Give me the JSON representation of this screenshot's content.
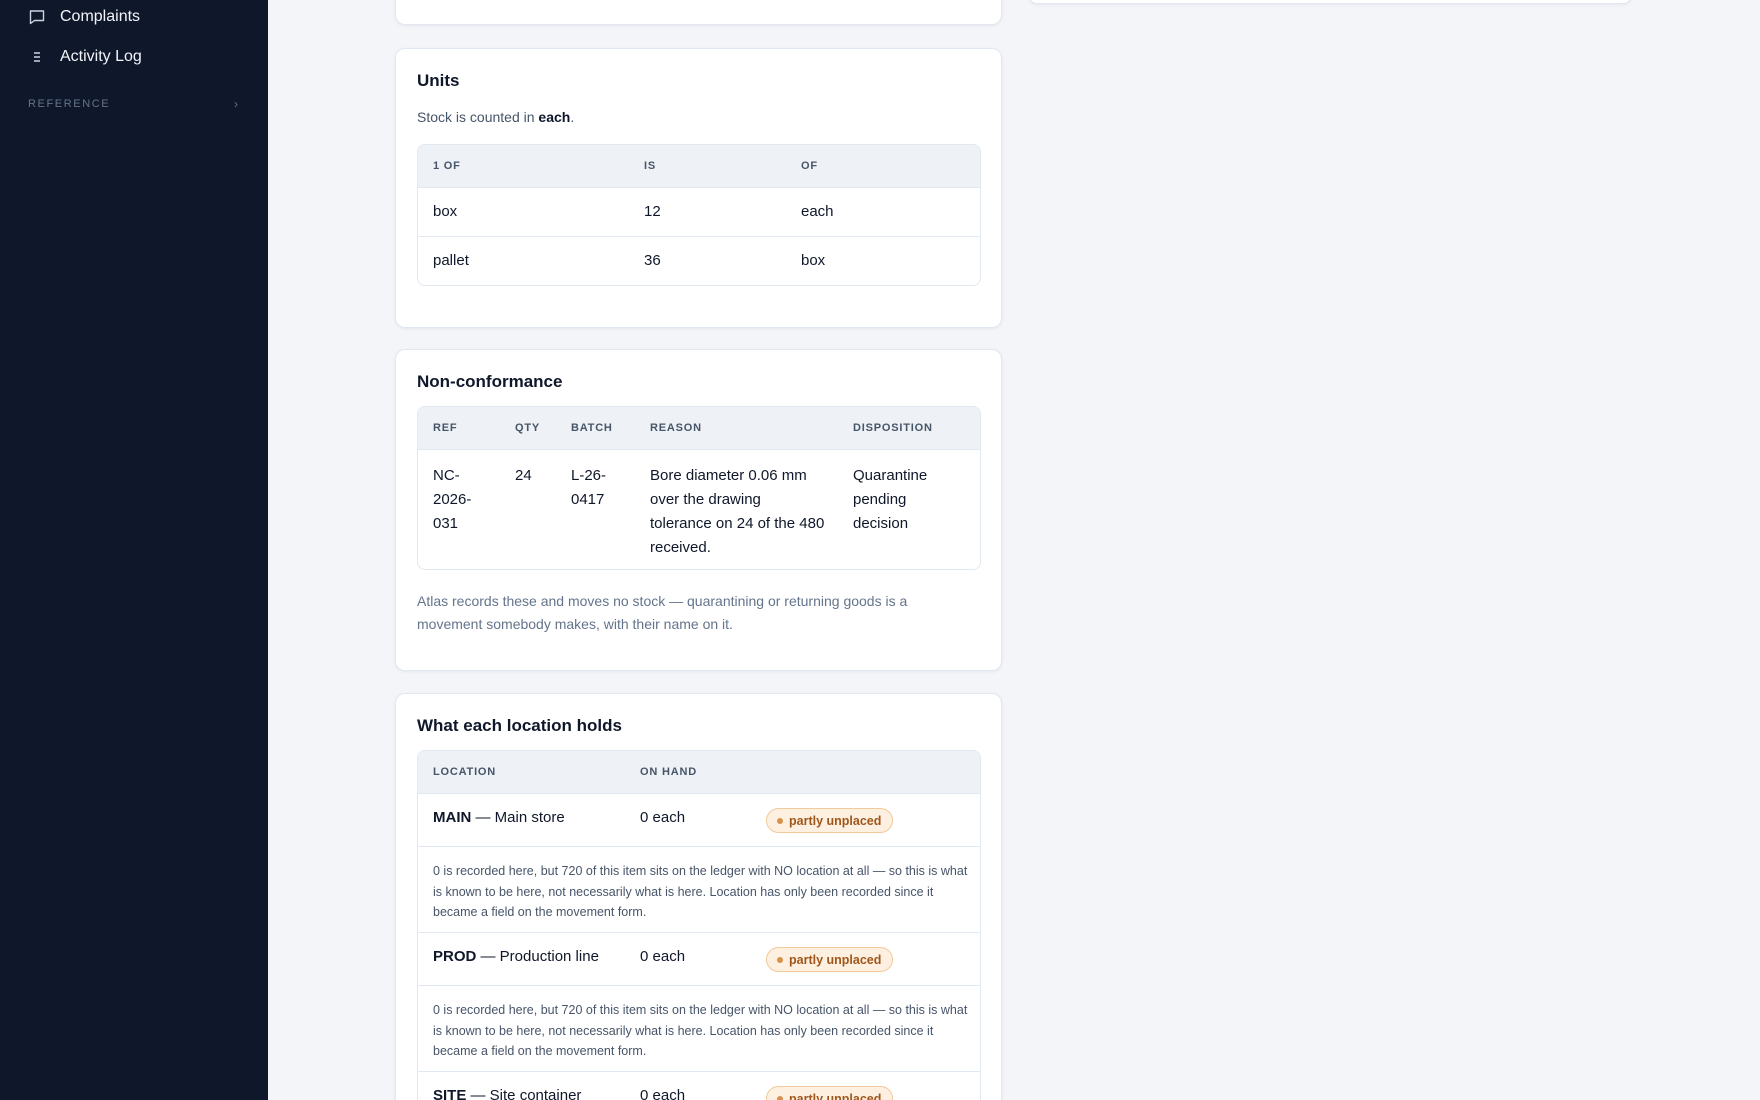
{
  "sidebar": {
    "items": [
      {
        "label": "Complaints",
        "icon": "message-square-icon"
      },
      {
        "label": "Activity Log",
        "icon": "list-icon"
      }
    ],
    "section": {
      "label": "REFERENCE"
    }
  },
  "units": {
    "title": "Units",
    "subtitle_prefix": "Stock is counted in ",
    "subtitle_unit": "each",
    "subtitle_suffix": ".",
    "columns": [
      "1 OF",
      "IS",
      "OF"
    ],
    "rows": [
      {
        "unit": "box",
        "qty": "12",
        "of": "each"
      },
      {
        "unit": "pallet",
        "qty": "36",
        "of": "box"
      }
    ]
  },
  "nonconformance": {
    "title": "Non-conformance",
    "columns": [
      "REF",
      "QTY",
      "BATCH",
      "REASON",
      "DISPOSITION"
    ],
    "rows": [
      {
        "ref": "NC-2026-031",
        "qty": "24",
        "batch": "L-26-0417",
        "reason": "Bore diameter 0.06 mm over the drawing tolerance on 24 of the 480 received.",
        "disposition": "Quarantine pending decision"
      }
    ],
    "note": "Atlas records these and moves no stock — quarantining or returning goods is a movement somebody makes, with their name on it."
  },
  "locations": {
    "title": "What each location holds",
    "columns": [
      "LOCATION",
      "ON HAND"
    ],
    "rows": [
      {
        "code": "MAIN",
        "name": " — Main store",
        "on_hand": "0 each",
        "badge": "partly unplaced",
        "note": "0 is recorded here, but 720 of this item sits on the ledger with NO location at all — so this is what is known to be here, not necessarily what is here. Location has only been recorded since it became a field on the movement form."
      },
      {
        "code": "PROD",
        "name": " — Production line",
        "on_hand": "0 each",
        "badge": "partly unplaced",
        "note": "0 is recorded here, but 720 of this item sits on the ledger with NO location at all — so this is what is known to be here, not necessarily what is here. Location has only been recorded since it became a field on the movement form."
      },
      {
        "code": "SITE",
        "name": " — Site container",
        "on_hand": "0 each",
        "badge": "partly unplaced"
      }
    ]
  },
  "colors": {
    "sidebar_bg": "#0f172a",
    "page_bg": "#f3f5f9",
    "badge_bg": "#fdf0e1",
    "badge_text": "#a0561a"
  }
}
